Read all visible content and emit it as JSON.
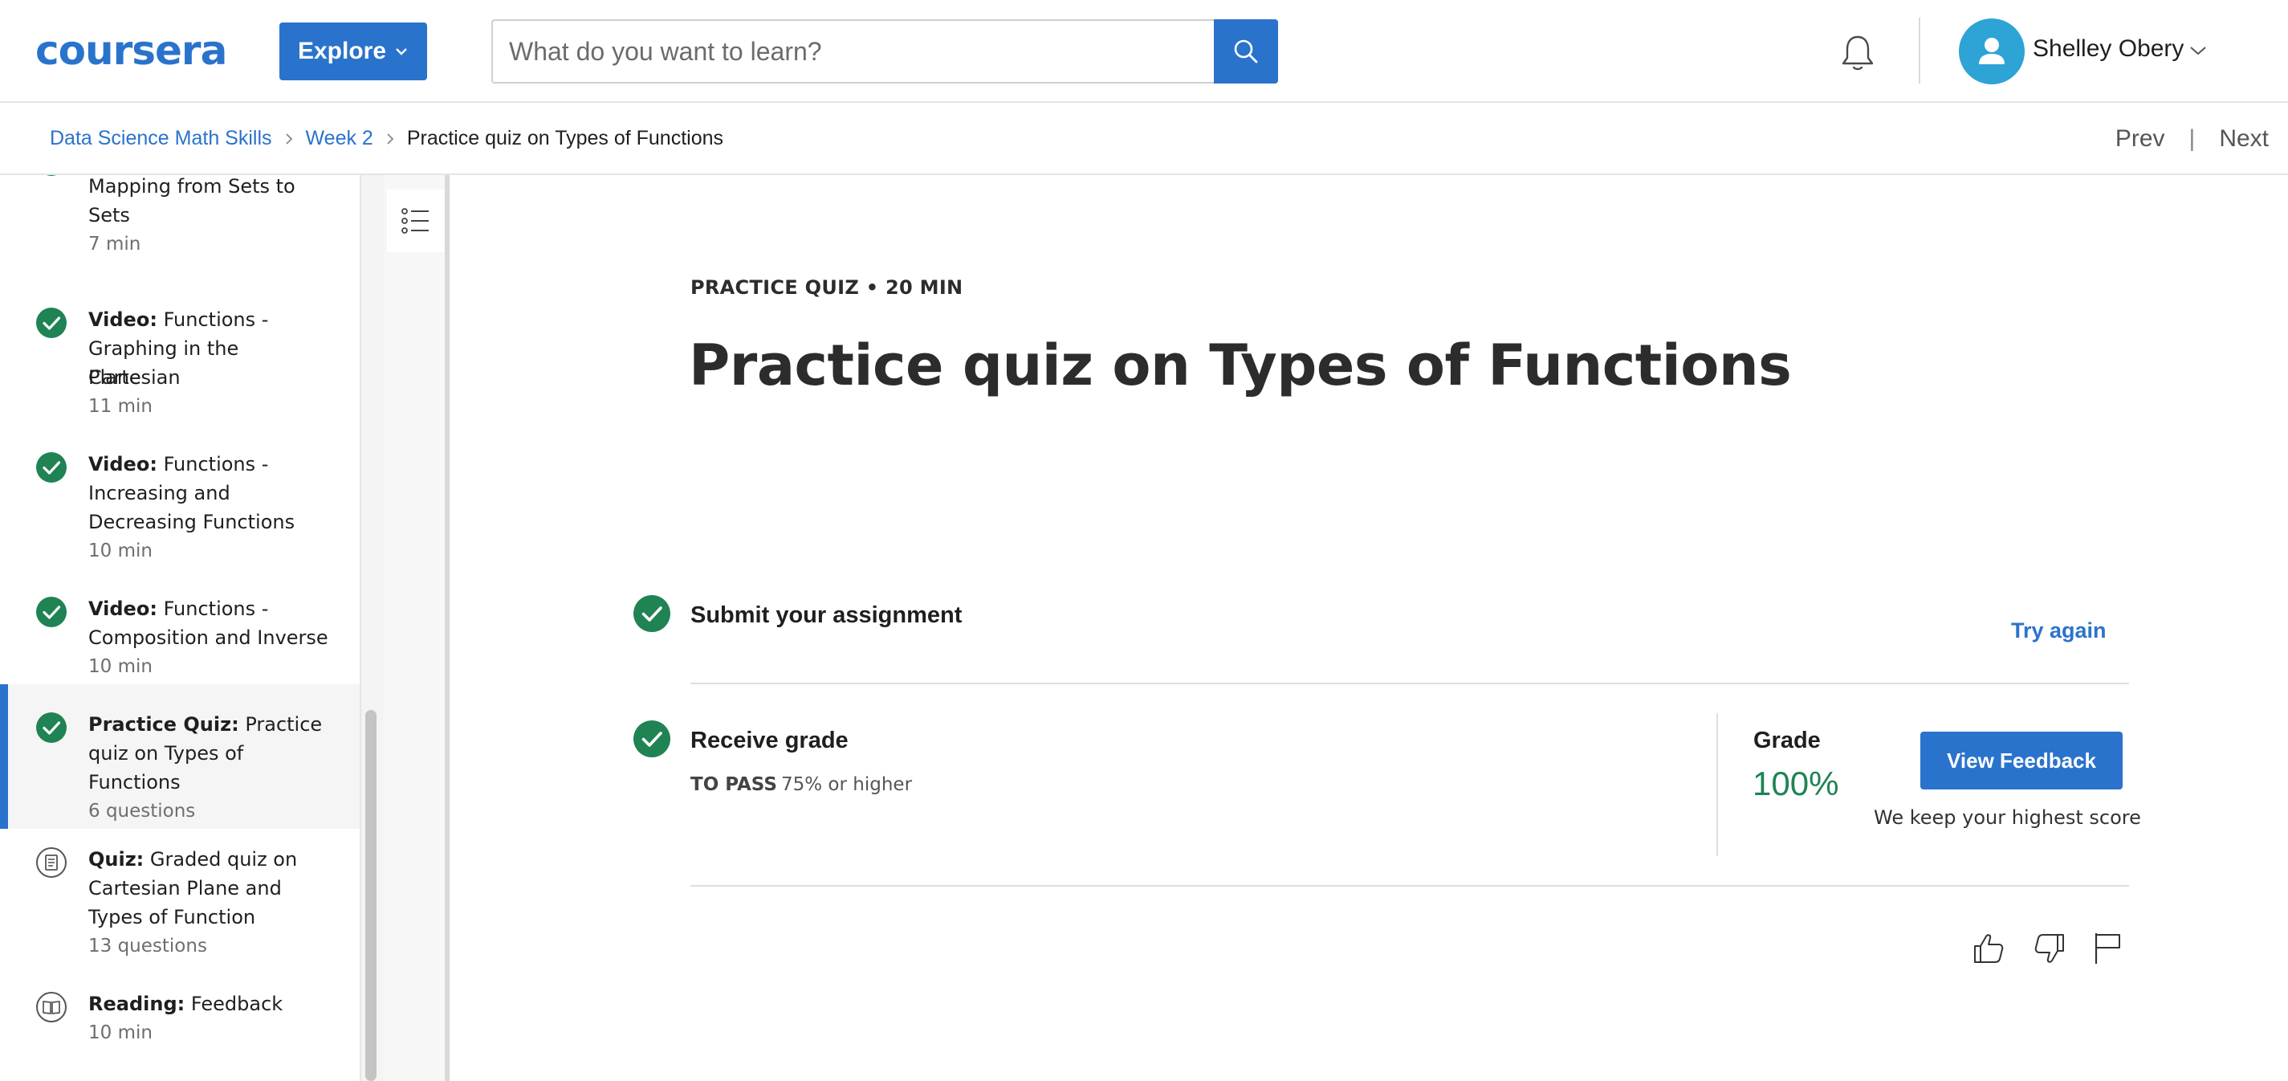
{
  "header": {
    "logo": "coursera",
    "explore_label": "Explore",
    "search_placeholder": "What do you want to learn?",
    "user_name": "Shelley Obery"
  },
  "breadcrumb": {
    "items": [
      "Data Science Math Skills",
      "Week 2"
    ],
    "current": "Practice quiz on Types of Functions",
    "prev_label": "Prev",
    "next_label": "Next"
  },
  "sidebar": {
    "items": [
      {
        "kind": "",
        "title": "Mapping from Sets to Sets",
        "line1": "Mapping from Sets to",
        "line2": "Sets",
        "meta": "7 min",
        "status": "completed"
      },
      {
        "kind": "Video:",
        "title": "Functions - Graphing in the Cartesian Plane",
        "line1": "Functions -",
        "line2": "Graphing in the Cartesian",
        "line3": "Plane",
        "meta": "11 min",
        "status": "completed"
      },
      {
        "kind": "Video:",
        "title": "Functions - Increasing and Decreasing Functions",
        "line1": "Functions -",
        "line2": "Increasing and",
        "line3": "Decreasing Functions",
        "meta": "10 min",
        "status": "completed"
      },
      {
        "kind": "Video:",
        "title": "Functions - Composition and Inverse",
        "line1": "Functions -",
        "line2": "Composition and Inverse",
        "meta": "10 min",
        "status": "completed"
      },
      {
        "kind": "Practice Quiz:",
        "title": "Practice quiz on Types of Functions",
        "line1": "Practice",
        "line2": "quiz on Types of",
        "line3": "Functions",
        "meta": "6 questions",
        "status": "completed-active"
      },
      {
        "kind": "Quiz:",
        "title": "Graded quiz on Cartesian Plane and Types of Function",
        "line1": "Graded quiz on",
        "line2": "Cartesian Plane and",
        "line3": "Types of Function",
        "meta": "13 questions",
        "status": "quiz"
      },
      {
        "kind": "Reading:",
        "title": "Feedback",
        "line1": "Feedback",
        "meta": "10 min",
        "status": "reading"
      }
    ]
  },
  "main": {
    "kicker": "PRACTICE QUIZ • 20 MIN",
    "title": "Practice quiz on Types of Functions",
    "submit_title": "Submit your assignment",
    "try_again_label": "Try again",
    "receive_title": "Receive grade",
    "to_pass_label": "TO PASS",
    "to_pass_value": "75% or higher",
    "grade_label": "Grade",
    "grade_value": "100%",
    "view_feedback_label": "View Feedback",
    "keep_note": "We keep your highest score"
  },
  "colors": {
    "brand_blue": "#2a73cc",
    "success_green": "#1f8354",
    "avatar_blue": "#2ea3d6"
  },
  "icons": [
    "search-icon",
    "bell-icon",
    "user-icon",
    "chevron-down-icon",
    "check-circle-icon",
    "quiz-icon",
    "reading-icon",
    "outline-list-icon",
    "thumbs-up-icon",
    "thumbs-down-icon",
    "flag-icon"
  ]
}
